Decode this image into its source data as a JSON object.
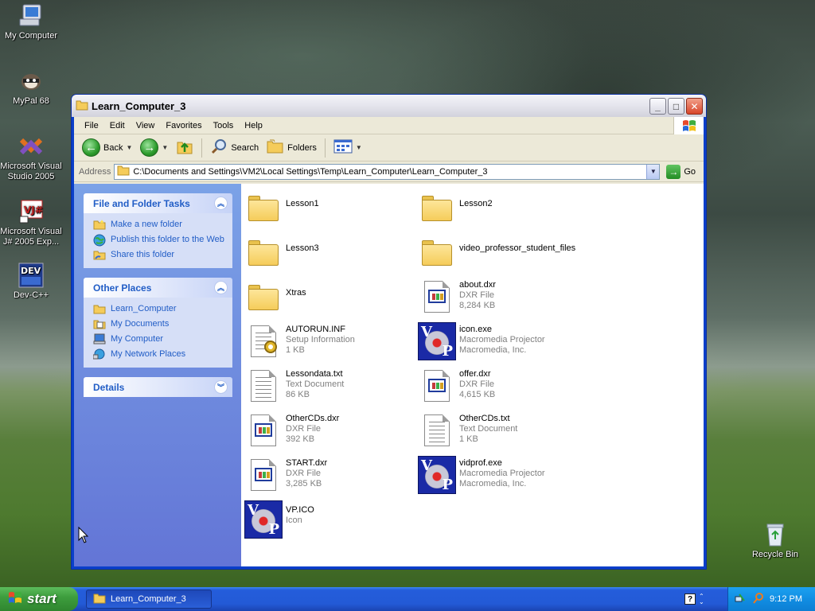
{
  "desktop": {
    "icons": [
      {
        "label": "My Computer"
      },
      {
        "label": "MyPal 68"
      },
      {
        "label": "Microsoft Visual Studio 2005"
      },
      {
        "label": "Microsoft Visual J# 2005 Exp..."
      },
      {
        "label": "Dev-C++"
      },
      {
        "label": "Recycle Bin"
      }
    ]
  },
  "window": {
    "title": "Learn_Computer_3",
    "menu": [
      "File",
      "Edit",
      "View",
      "Favorites",
      "Tools",
      "Help"
    ],
    "toolbar": {
      "back": "Back",
      "search": "Search",
      "folders": "Folders"
    },
    "address": {
      "label": "Address",
      "value": "C:\\Documents and Settings\\VM2\\Local Settings\\Temp\\Learn_Computer\\Learn_Computer_3",
      "go": "Go"
    }
  },
  "taskpane": {
    "file_tasks": {
      "title": "File and Folder Tasks",
      "items": [
        "Make a new folder",
        "Publish this folder to the Web",
        "Share this folder"
      ]
    },
    "other_places": {
      "title": "Other Places",
      "items": [
        "Learn_Computer",
        "My Documents",
        "My Computer",
        "My Network Places"
      ]
    },
    "details": {
      "title": "Details"
    }
  },
  "files": [
    {
      "name": "Lesson1",
      "type": "",
      "size": "",
      "icon": "folder-icon"
    },
    {
      "name": "Lesson2",
      "type": "",
      "size": "",
      "icon": "folder-icon"
    },
    {
      "name": "Lesson3",
      "type": "",
      "size": "",
      "icon": "folder-icon"
    },
    {
      "name": "video_professor_student_files",
      "type": "",
      "size": "",
      "icon": "folder-icon"
    },
    {
      "name": "Xtras",
      "type": "",
      "size": "",
      "icon": "folder-icon"
    },
    {
      "name": "about.dxr",
      "type": "DXR File",
      "size": "8,284 KB",
      "icon": "dxr-file-icon"
    },
    {
      "name": "AUTORUN.INF",
      "type": "Setup Information",
      "size": "1 KB",
      "icon": "setup-info-icon"
    },
    {
      "name": "icon.exe",
      "type": "Macromedia Projector",
      "size": "Macromedia, Inc.",
      "icon": "macromedia-projector-icon"
    },
    {
      "name": "Lessondata.txt",
      "type": "Text Document",
      "size": "86 KB",
      "icon": "text-document-icon"
    },
    {
      "name": "offer.dxr",
      "type": "DXR File",
      "size": "4,615 KB",
      "icon": "dxr-file-icon"
    },
    {
      "name": "OtherCDs.dxr",
      "type": "DXR File",
      "size": "392 KB",
      "icon": "dxr-file-icon"
    },
    {
      "name": "OtherCDs.txt",
      "type": "Text Document",
      "size": "1 KB",
      "icon": "text-document-icon"
    },
    {
      "name": "START.dxr",
      "type": "DXR File",
      "size": "3,285 KB",
      "icon": "dxr-file-icon"
    },
    {
      "name": "vidprof.exe",
      "type": "Macromedia Projector",
      "size": "Macromedia, Inc.",
      "icon": "macromedia-projector-icon"
    },
    {
      "name": "VP.ICO",
      "type": "Icon",
      "size": "",
      "icon": "vp-icon-file-icon"
    }
  ],
  "taskbar": {
    "start": "start",
    "task": "Learn_Computer_3",
    "clock": "9:12 PM"
  }
}
